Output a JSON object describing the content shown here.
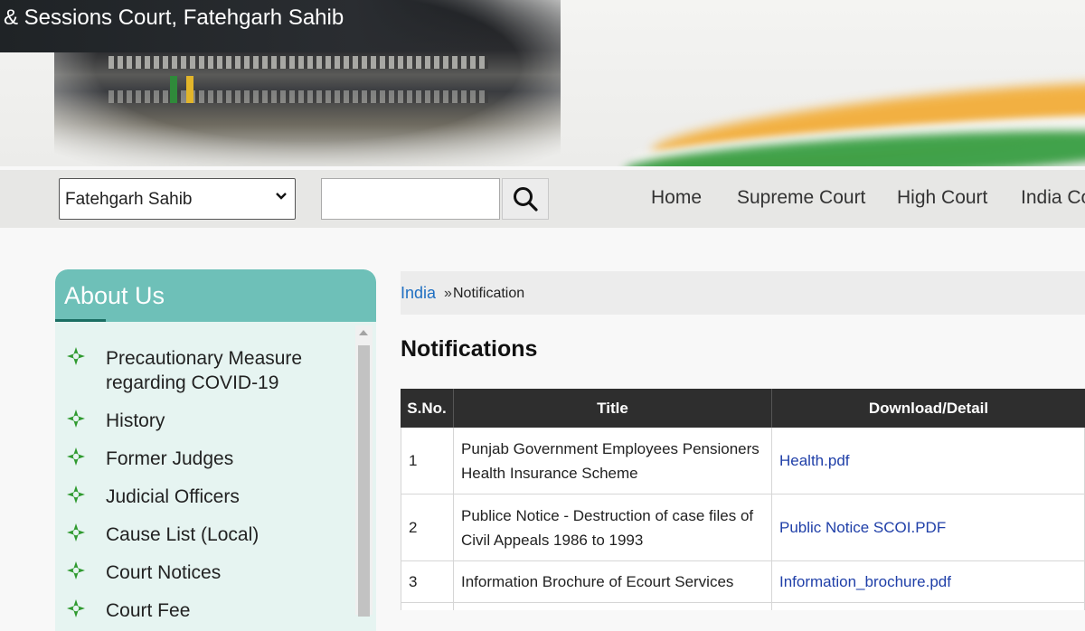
{
  "header": {
    "title": "& Sessions Court, Fatehgarh Sahib"
  },
  "nav": {
    "district_select": "Fatehgarh Sahib",
    "search_placeholder": "",
    "links": [
      "Home",
      "Supreme Court",
      "High Court",
      "India Co"
    ]
  },
  "sidebar": {
    "title": "About Us",
    "items": [
      {
        "label": "Precautionary Measure regarding COVID-19"
      },
      {
        "label": "History"
      },
      {
        "label": "Former Judges"
      },
      {
        "label": "Judicial Officers"
      },
      {
        "label": "Cause List (Local)"
      },
      {
        "label": "Court Notices"
      },
      {
        "label": "Court Fee"
      }
    ]
  },
  "breadcrumb": {
    "root": "India",
    "separator": "»",
    "current": "Notification"
  },
  "main": {
    "heading": "Notifications",
    "table": {
      "columns": [
        "S.No.",
        "Title",
        "Download/Detail"
      ],
      "rows": [
        {
          "sno": "1",
          "title": "Punjab Government Employees Pensioners Health Insurance Scheme",
          "download": "Health.pdf"
        },
        {
          "sno": "2",
          "title": "Publice Notice - Destruction of case files of Civil Appeals 1986 to 1993",
          "download": "Public Notice SCOI.PDF"
        },
        {
          "sno": "3",
          "title": "Information Brochure of Ecourt Services",
          "download": "Information_brochure.pdf"
        }
      ]
    }
  },
  "colors": {
    "sidebar_header": "#6ec0b8",
    "sidebar_bg": "#e6f4f1",
    "table_header": "#2e2e2e",
    "link": "#1f6fc2"
  },
  "icons": {
    "sidebar_bullet": "green-diamond-cross-icon",
    "search": "search-icon",
    "select": "chevron-down-icon"
  }
}
